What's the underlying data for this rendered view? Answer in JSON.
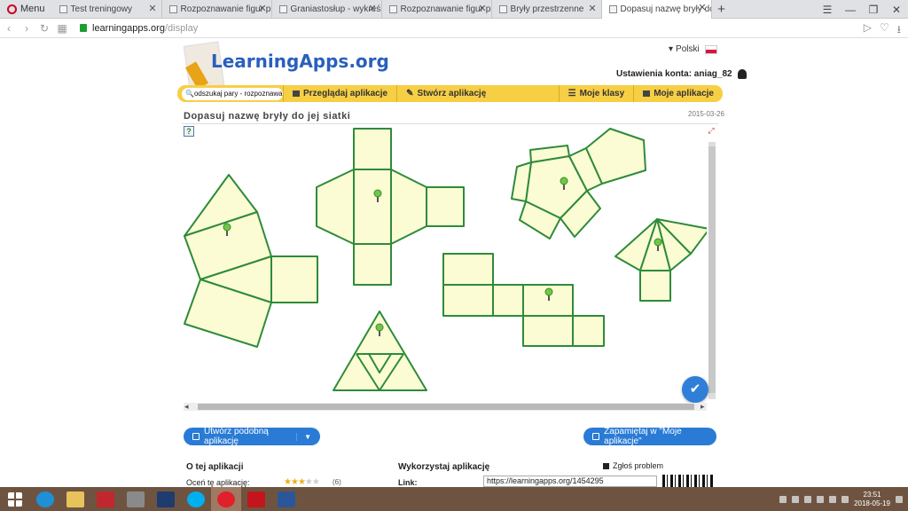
{
  "browser": {
    "menu_label": "Menu",
    "tabs": [
      {
        "title": "Test treningowy",
        "active": false
      },
      {
        "title": "Rozpoznawanie figur prze",
        "active": false
      },
      {
        "title": "Graniastosłup - wykreślan",
        "active": false
      },
      {
        "title": "Rozpoznawanie figur prze",
        "active": false
      },
      {
        "title": "Bryły przestrzenne",
        "active": false
      },
      {
        "title": "Dopasuj nazwę bryły do je",
        "active": true
      }
    ],
    "new_tab_icon": "+",
    "url_host": "learningapps.org",
    "url_path": "/display"
  },
  "header": {
    "logo_text": "LearningApps.org",
    "language": "Polski",
    "account_label": "Ustawienia konta: aniag_82"
  },
  "menubar": {
    "search_value": "odszukaj pary - rozpoznawanie",
    "items": [
      {
        "label": "Przeglądaj aplikacje"
      },
      {
        "label": "Stwórz aplikację"
      },
      {
        "label": "Moje klasy"
      },
      {
        "label": "Moje aplikacje"
      }
    ]
  },
  "app": {
    "title": "Dopasuj nazwę bryły do jej siatki",
    "date": "2015-03-26"
  },
  "buttons": {
    "similar": "Utwórz podobną aplikację",
    "remember": "Zapamiętaj w \"Moje aplikacje\""
  },
  "about": {
    "title": "O tej aplikacji",
    "rate_label": "Oceń tę aplikację:",
    "rating": 3,
    "votes": "(6)"
  },
  "use": {
    "title": "Wykorzystaj aplikację",
    "link_label": "Link:",
    "link_value": "https://learningapps.org/1454295",
    "report_label": "Zgłoś problem"
  },
  "taskbar": {
    "time": "23:51",
    "date": "2018-05-19"
  },
  "colors": {
    "accent_yellow": "#f7cf45",
    "button_blue": "#2a7bd5",
    "net_fill": "#fbfcd4",
    "net_stroke": "#2e8b3a"
  }
}
